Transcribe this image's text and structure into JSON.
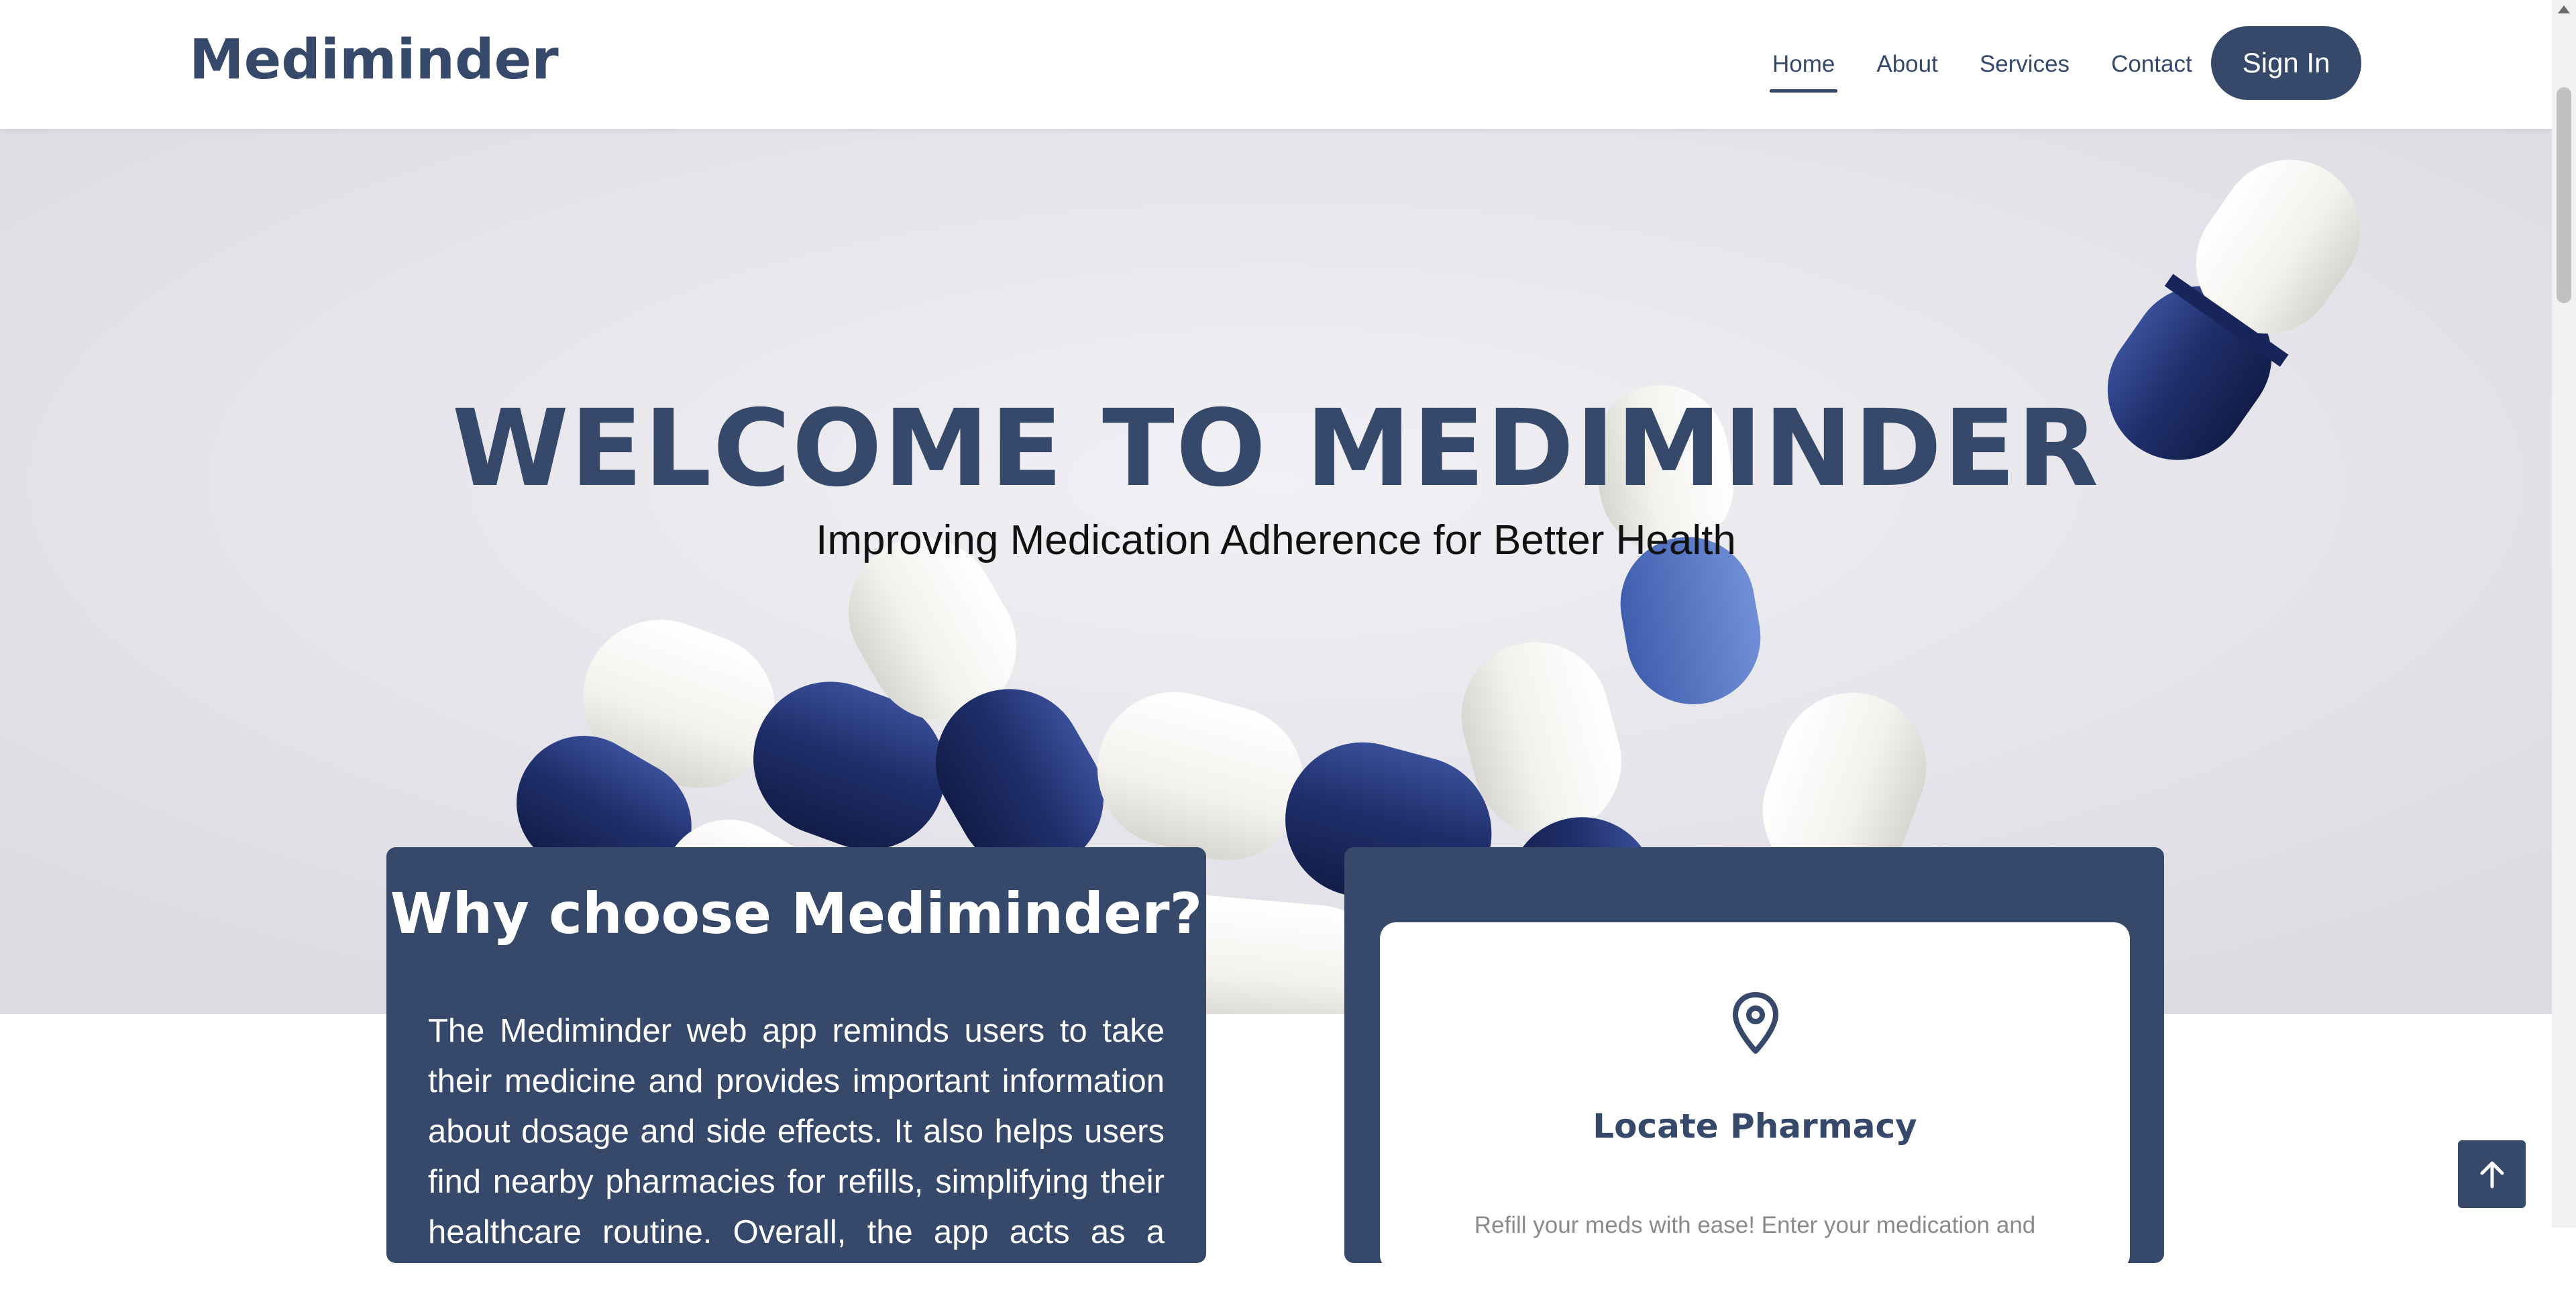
{
  "header": {
    "brand": "Mediminder",
    "nav": {
      "home": "Home",
      "about": "About",
      "services": "Services",
      "contact": "Contact"
    },
    "sign_in": "Sign In"
  },
  "hero": {
    "title": "WELCOME TO MEDIMINDER",
    "subtitle": "Improving Medication Adherence for Better Health"
  },
  "why_card": {
    "heading": "Why choose Mediminder?",
    "body": "The Mediminder web app reminds users to take their medicine and provides important information about dosage and side effects. It also helps users find nearby pharmacies for refills, simplifying their healthcare routine. Overall, the app acts as a helpful"
  },
  "service_card": {
    "icon": "map-pin-icon",
    "title": "Locate Pharmacy",
    "description": "Refill your meds with ease! Enter your medication and"
  },
  "colors": {
    "primary": "#36496a",
    "hero_bg": "#ebeaef",
    "capsule_blue": "#1f2f6b",
    "capsule_white": "#f7f6f2"
  }
}
